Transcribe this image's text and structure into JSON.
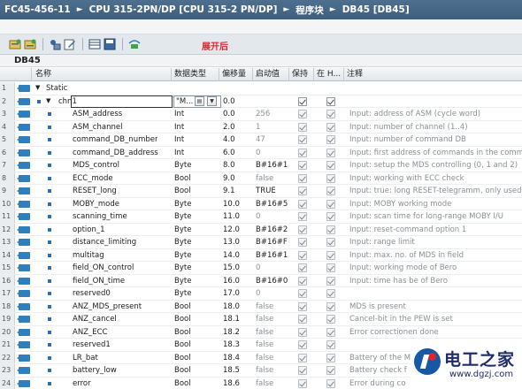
{
  "breadcrumb": [
    "FC45-456-11",
    "CPU 315-2PN/DP [CPU 315-2 PN/DP]",
    "程序块",
    "DB45 [DB45]"
  ],
  "toolbar": {
    "expand_label": "展开后"
  },
  "block_name": "DB45",
  "columns": {
    "name": "名称",
    "type": "数据类型",
    "offset": "偏移量",
    "start": "启动值",
    "retain": "保持",
    "inhmi": "在 H...",
    "comment": "注释"
  },
  "rows": [
    {
      "num": "1",
      "name": "Static",
      "type": "",
      "offset": "",
      "start": "",
      "comment": ""
    },
    {
      "num": "2",
      "name": "chn1",
      "type": "\"M...",
      "offset": "0.0",
      "start": "",
      "comment": ""
    },
    {
      "num": "3",
      "name": "ASM_address",
      "type": "Int",
      "offset": "0.0",
      "start": "256",
      "comment": "Input: address of ASM (cycle word)"
    },
    {
      "num": "4",
      "name": "ASM_channel",
      "type": "Int",
      "offset": "2.0",
      "start": "1",
      "comment": "Input: number of channel (1..4)"
    },
    {
      "num": "5",
      "name": "command_DB_number",
      "type": "Int",
      "offset": "4.0",
      "start": "47",
      "comment": "Input: number of command DB"
    },
    {
      "num": "6",
      "name": "command_DB_address",
      "type": "Int",
      "offset": "6.0",
      "start": "0",
      "comment": "Input: first address of commands in the comma"
    },
    {
      "num": "7",
      "name": "MDS_control",
      "type": "Byte",
      "offset": "8.0",
      "start": "B#16#1",
      "comment": "Input: setup the MDS controlling (0, 1 and 2)"
    },
    {
      "num": "8",
      "name": "ECC_mode",
      "type": "Bool",
      "offset": "9.0",
      "start": "false",
      "comment": "Input: working with ECC check"
    },
    {
      "num": "9",
      "name": "RESET_long",
      "type": "Bool",
      "offset": "9.1",
      "start": "TRUE",
      "comment": "Input: true: long RESET-telegramm, only used fo"
    },
    {
      "num": "10",
      "name": "MOBY_mode",
      "type": "Byte",
      "offset": "10.0",
      "start": "B#16#5",
      "comment": "Input: MOBY working mode"
    },
    {
      "num": "11",
      "name": "scanning_time",
      "type": "Byte",
      "offset": "11.0",
      "start": "0",
      "comment": "Input: scan time for long-range MOBY I/U"
    },
    {
      "num": "12",
      "name": "option_1",
      "type": "Byte",
      "offset": "12.0",
      "start": "B#16#2",
      "comment": "Input: reset-command option 1"
    },
    {
      "num": "13",
      "name": "distance_limiting",
      "type": "Byte",
      "offset": "13.0",
      "start": "B#16#F",
      "comment": "Input: range limit"
    },
    {
      "num": "14",
      "name": "multitag",
      "type": "Byte",
      "offset": "14.0",
      "start": "B#16#1",
      "comment": "Input: max. no. of MDS in field"
    },
    {
      "num": "15",
      "name": "field_ON_control",
      "type": "Byte",
      "offset": "15.0",
      "start": "0",
      "comment": "Input: working mode of Bero"
    },
    {
      "num": "16",
      "name": "field_ON_time",
      "type": "Byte",
      "offset": "16.0",
      "start": "B#16#0",
      "comment": "Input: time has be of Bero"
    },
    {
      "num": "17",
      "name": "reserved0",
      "type": "Byte",
      "offset": "17.0",
      "start": "0",
      "comment": ""
    },
    {
      "num": "18",
      "name": "ANZ_MDS_present",
      "type": "Bool",
      "offset": "18.0",
      "start": "false",
      "comment": "MDS is present"
    },
    {
      "num": "19",
      "name": "ANZ_cancel",
      "type": "Bool",
      "offset": "18.1",
      "start": "false",
      "comment": "Cancel-bit in the PEW is set"
    },
    {
      "num": "20",
      "name": "ANZ_ECC",
      "type": "Bool",
      "offset": "18.2",
      "start": "false",
      "comment": "Error correctionen done"
    },
    {
      "num": "21",
      "name": "reserved1",
      "type": "Bool",
      "offset": "18.3",
      "start": "false",
      "comment": ""
    },
    {
      "num": "22",
      "name": "LR_bat",
      "type": "Bool",
      "offset": "18.4",
      "start": "false",
      "comment": "Battery of the M"
    },
    {
      "num": "23",
      "name": "battery_low",
      "type": "Bool",
      "offset": "18.5",
      "start": "false",
      "comment": "Battery check f"
    },
    {
      "num": "24",
      "name": "error",
      "type": "Bool",
      "offset": "18.6",
      "start": "false",
      "comment": "Error during co"
    }
  ],
  "watermark": {
    "text": "电工之家",
    "url": "www.dgzj.com"
  }
}
